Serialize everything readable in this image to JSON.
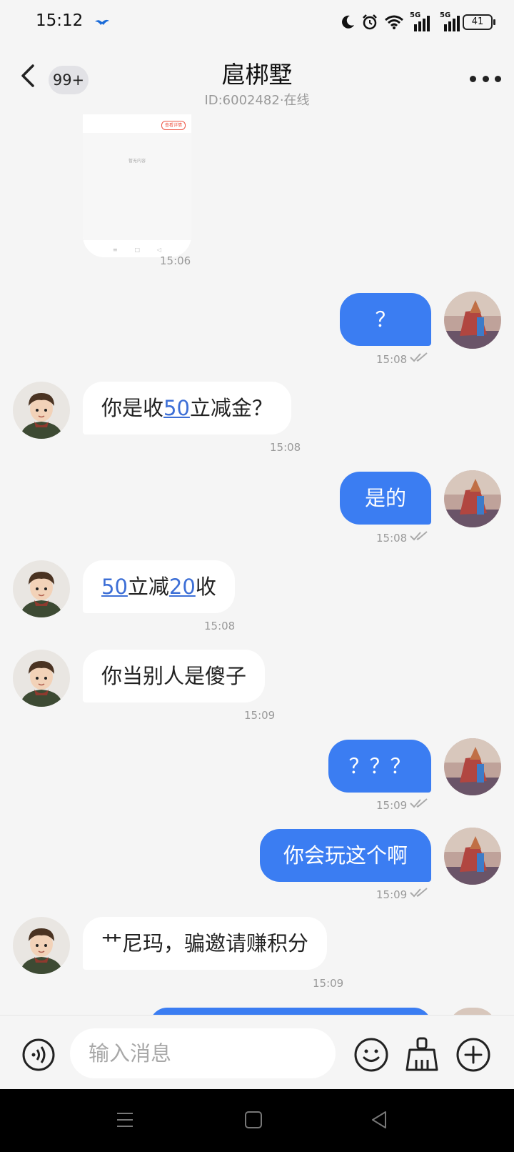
{
  "status_bar": {
    "time": "15:12",
    "signal_label_1": "5G",
    "signal_label_2": "5G",
    "battery": "41"
  },
  "header": {
    "back_label": "返回",
    "unread_badge": "99+",
    "title": "扈梆墅",
    "subtitle": "ID:6002482·在线"
  },
  "image_message": {
    "pill_text": "查看详情",
    "mini_text": "暂无内容",
    "time": "15:06"
  },
  "messages": [
    {
      "id": 1,
      "side": "out",
      "text": "？",
      "time": "15:08"
    },
    {
      "id": 2,
      "side": "in",
      "parts": [
        "你是收",
        "50",
        "立减金？"
      ],
      "time": "15:08"
    },
    {
      "id": 3,
      "side": "out",
      "text": "是的",
      "time": "15:08"
    },
    {
      "id": 4,
      "side": "in",
      "parts": [
        "50",
        "立减",
        "20",
        "收"
      ],
      "time": "15:08"
    },
    {
      "id": 5,
      "side": "in",
      "text": "你当别人是傻子",
      "time": "15:09"
    },
    {
      "id": 6,
      "side": "out",
      "text": "？？？",
      "time": "15:09"
    },
    {
      "id": 7,
      "side": "out",
      "text": "你会玩这个啊",
      "time": "15:09"
    },
    {
      "id": 8,
      "side": "in",
      "text": "艹尼玛，骗邀请赚积分",
      "time": "15:09"
    }
  ],
  "input": {
    "placeholder": "输入消息",
    "value": ""
  },
  "colors": {
    "accent": "#3b7df2",
    "link": "#3d6fd6",
    "background": "#f5f5f5"
  }
}
